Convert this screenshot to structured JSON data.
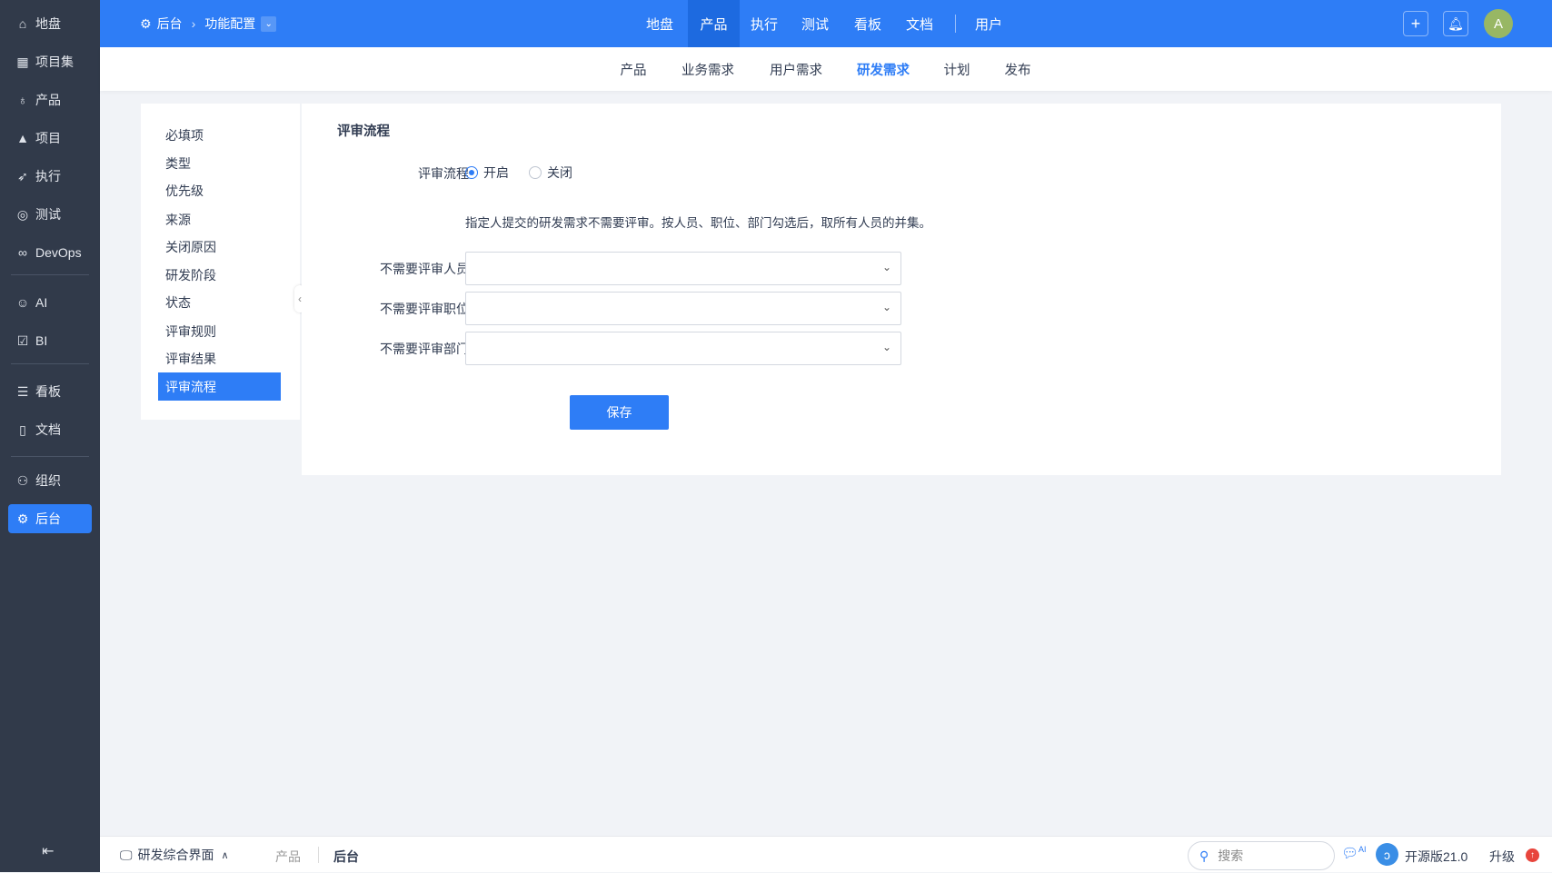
{
  "sidebar": {
    "items": [
      {
        "label": "地盘",
        "icon": "home-icon"
      },
      {
        "label": "项目集",
        "icon": "grid-icon"
      },
      {
        "label": "产品",
        "icon": "bulb-icon"
      },
      {
        "label": "项目",
        "icon": "rocket-icon"
      },
      {
        "label": "执行",
        "icon": "run-icon"
      },
      {
        "label": "测试",
        "icon": "bug-search-icon"
      },
      {
        "label": "DevOps",
        "icon": "infinity-icon"
      },
      {
        "label": "AI",
        "icon": "robot-icon"
      },
      {
        "label": "BI",
        "icon": "chart-icon"
      },
      {
        "label": "看板",
        "icon": "kanban-icon"
      },
      {
        "label": "文档",
        "icon": "doc-icon"
      },
      {
        "label": "组织",
        "icon": "users-icon"
      },
      {
        "label": "后台",
        "icon": "gear-icon"
      }
    ],
    "collapse_icon": "collapse-left-icon"
  },
  "topbar": {
    "breadcrumb": [
      "后台",
      "功能配置"
    ],
    "nav": [
      "地盘",
      "产品",
      "执行",
      "测试",
      "看板",
      "文档"
    ],
    "nav_user": "用户",
    "active_nav": "产品",
    "avatar": "A"
  },
  "subnav": {
    "items": [
      "产品",
      "业务需求",
      "用户需求",
      "研发需求",
      "计划",
      "发布"
    ],
    "active": "研发需求"
  },
  "leftmenu": {
    "items": [
      "必填项",
      "类型",
      "优先级",
      "来源",
      "关闭原因",
      "研发阶段",
      "状态",
      "评审规则",
      "评审结果",
      "评审流程"
    ],
    "active": "评审流程"
  },
  "main": {
    "title": "评审流程",
    "review_label": "评审流程",
    "opt_on": "开启",
    "opt_off": "关闭",
    "note": "指定人提交的研发需求不需要评审。按人员、职位、部门勾选后，取所有人员的并集。",
    "field_users": "不需要评审人员",
    "field_roles": "不需要评审职位",
    "field_depts": "不需要评审部门",
    "save": "保存"
  },
  "footer": {
    "app_switch": "研发综合界面",
    "crumb1": "产品",
    "crumb2": "后台",
    "search_placeholder": "搜索",
    "version": "开源版21.0",
    "upgrade": "升级",
    "ai_badge": "AI"
  }
}
